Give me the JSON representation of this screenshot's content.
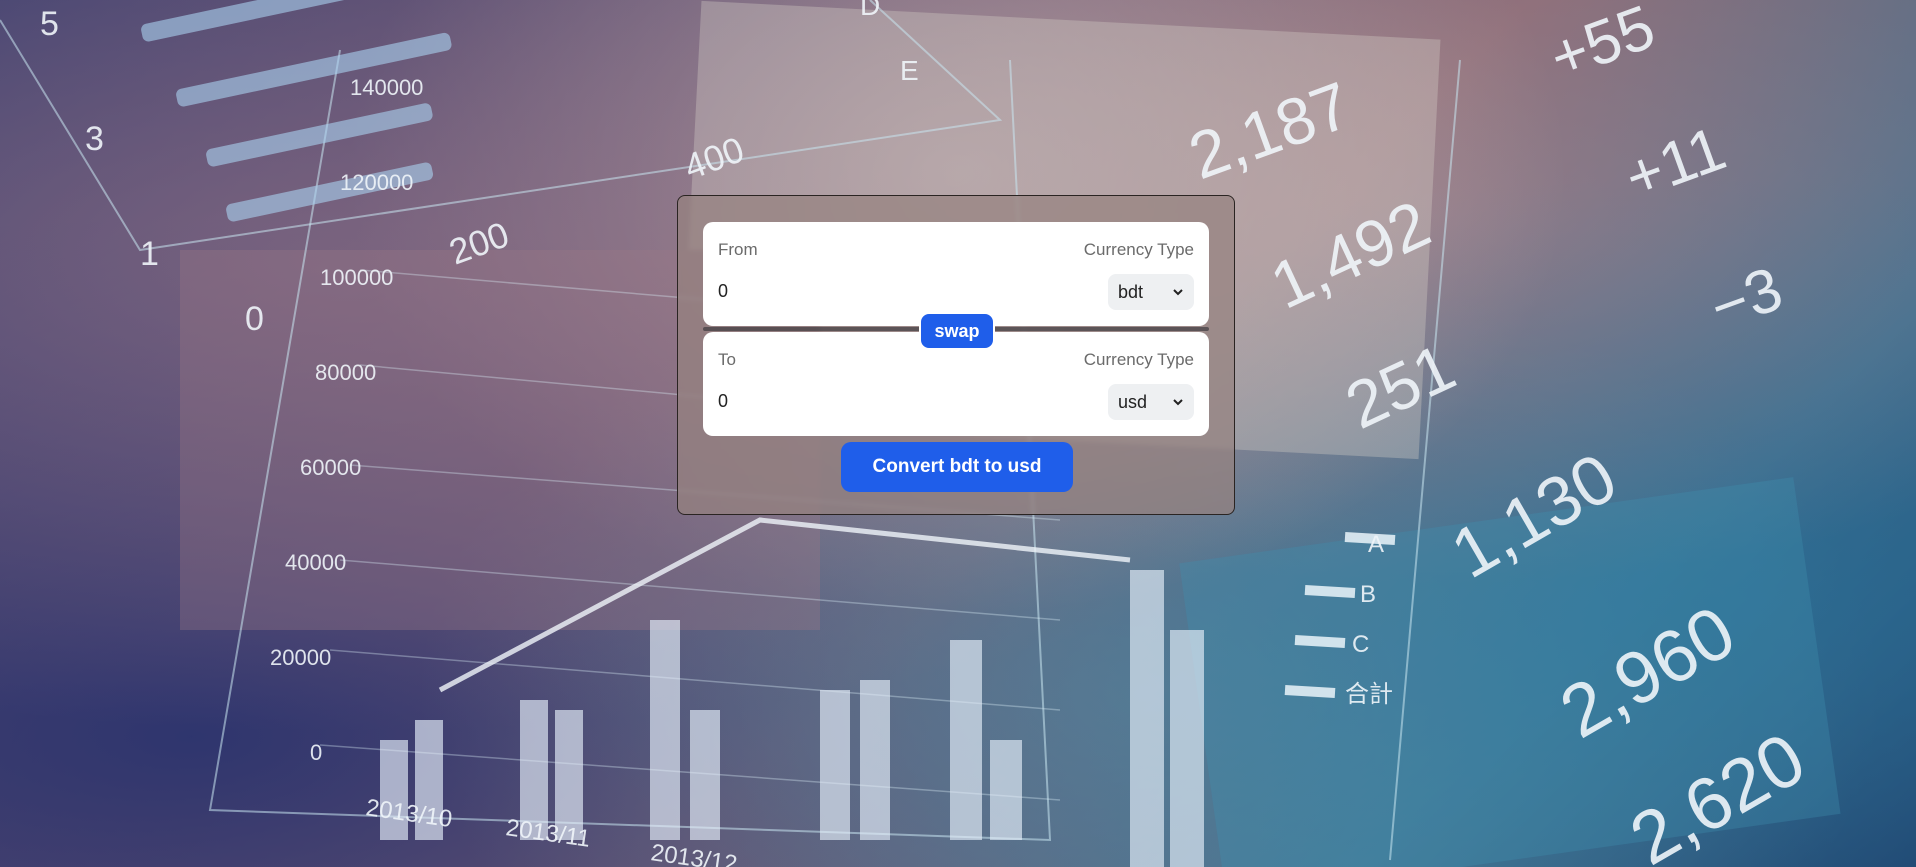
{
  "background": {
    "axis_labels_left": [
      "5",
      "3",
      "1",
      "0"
    ],
    "y_ticks": [
      "140000",
      "120000",
      "100000",
      "80000",
      "60000",
      "40000",
      "20000",
      "0"
    ],
    "x_ticks": [
      "2013/10",
      "2013/11",
      "2013/12"
    ],
    "diagonal_numbers": [
      "400",
      "200"
    ],
    "legend": [
      "A",
      "B",
      "C",
      "合計"
    ],
    "floating_numbers": [
      "2,187",
      "1,492",
      "251",
      "1,130",
      "2,960",
      "2,620",
      "+55",
      "+11",
      "−3"
    ],
    "letters": [
      "D",
      "E"
    ]
  },
  "converter": {
    "from": {
      "label": "From",
      "currency_label": "Currency Type",
      "amount": "0",
      "currency": "bdt"
    },
    "to": {
      "label": "To",
      "currency_label": "Currency Type",
      "amount": "0",
      "currency": "usd"
    },
    "swap_label": "swap",
    "convert_label": "Convert bdt to usd"
  },
  "colors": {
    "accent": "#1f5eea",
    "panel": "#968280",
    "field_bg": "#ffffff"
  }
}
